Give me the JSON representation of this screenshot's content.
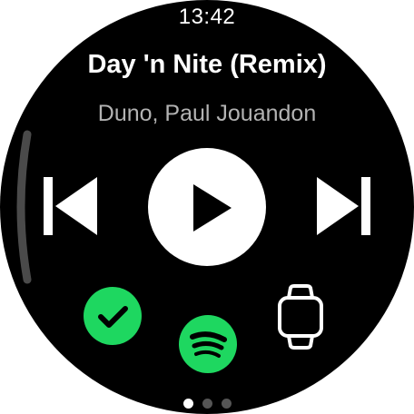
{
  "status": {
    "time": "13:42"
  },
  "track": {
    "title": "Day 'n Nite (Remix)",
    "artist": "Duno, Paul Jouandon"
  },
  "controls": {
    "previous": "previous-icon",
    "play": "play-icon",
    "next": "next-icon"
  },
  "actions": {
    "liked": "check-icon",
    "app": "spotify-icon",
    "device": "watch-icon"
  },
  "pager": {
    "pages": 3,
    "current": 1
  },
  "colors": {
    "background": "#000000",
    "accent": "#1ed760",
    "text_primary": "#ffffff",
    "text_secondary": "#b3b3b3"
  }
}
